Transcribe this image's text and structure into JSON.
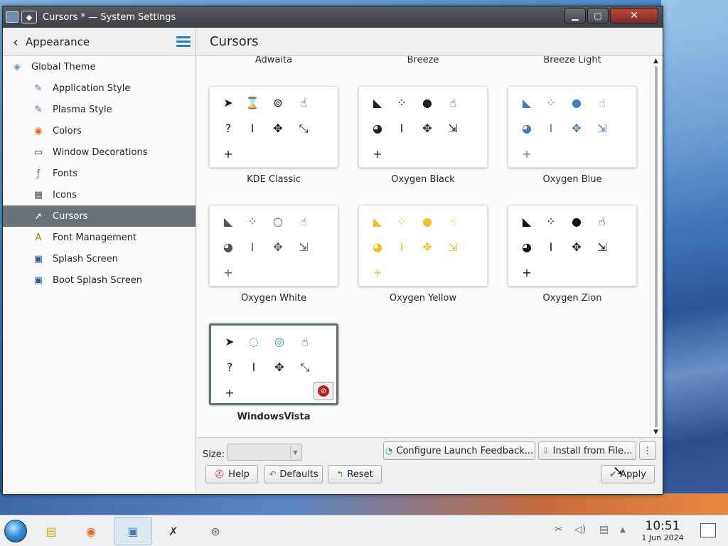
{
  "window": {
    "title": "Cursors * — System Settings",
    "controls": {
      "minimize": "▁",
      "maximize": "▢",
      "close": "✕"
    }
  },
  "sidebar": {
    "header": "Appearance",
    "items": [
      {
        "label": "Global Theme",
        "icon": "global-theme-icon",
        "level": "top"
      },
      {
        "label": "Application Style",
        "icon": "application-style-icon",
        "level": "sub"
      },
      {
        "label": "Plasma Style",
        "icon": "plasma-style-icon",
        "level": "sub"
      },
      {
        "label": "Colors",
        "icon": "colors-icon",
        "level": "sub"
      },
      {
        "label": "Window Decorations",
        "icon": "window-decorations-icon",
        "level": "sub"
      },
      {
        "label": "Fonts",
        "icon": "fonts-icon",
        "level": "sub"
      },
      {
        "label": "Icons",
        "icon": "icons-icon",
        "level": "sub"
      },
      {
        "label": "Cursors",
        "icon": "cursors-icon",
        "level": "sub",
        "active": true
      },
      {
        "label": "Font Management",
        "icon": "font-management-icon",
        "level": "sub"
      },
      {
        "label": "Splash Screen",
        "icon": "splash-screen-icon",
        "level": "sub"
      },
      {
        "label": "Boot Splash Screen",
        "icon": "boot-splash-screen-icon",
        "level": "sub"
      }
    ]
  },
  "main": {
    "title": "Cursors",
    "top_labels": [
      "Adwaita",
      "Breeze",
      "Breeze Light"
    ],
    "themes": [
      {
        "name": "KDE Classic",
        "style": "classic"
      },
      {
        "name": "Oxygen Black",
        "style": "black"
      },
      {
        "name": "Oxygen Blue",
        "style": "blue"
      },
      {
        "name": "Oxygen White",
        "style": "white"
      },
      {
        "name": "Oxygen Yellow",
        "style": "yellow"
      },
      {
        "name": "Oxygen Zion",
        "style": "zion"
      },
      {
        "name": "WindowsVista",
        "style": "vista",
        "selected": true
      }
    ]
  },
  "bottom": {
    "size_label": "Size:",
    "size_value": "",
    "configure_label": "Configure Launch Feedback...",
    "install_label": "Install from File...",
    "more_label": "⋮",
    "help_label": "Help",
    "defaults_label": "Defaults",
    "reset_label": "Reset",
    "apply_label": "Apply"
  },
  "taskbar": {
    "time": "10:51",
    "date": "1 Jun 2024"
  },
  "colors": {
    "accent": "#2a7ab9",
    "sidebar_active": "#6a7178",
    "selected_border": "#5d7176",
    "yellow": "#f0c020",
    "blue": "#3f7fc0"
  }
}
